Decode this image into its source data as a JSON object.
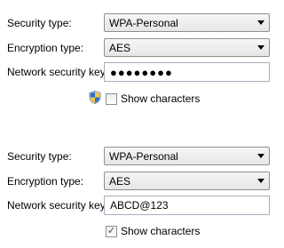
{
  "top_panel": {
    "security_type_label": "Security type:",
    "security_type_value": "WPA-Personal",
    "encryption_type_label": "Encryption type:",
    "encryption_type_value": "AES",
    "network_key_label": "Network security key",
    "network_key_value": "●●●●●●●●",
    "show_characters_label": "Show characters",
    "show_characters_checked": false,
    "shield_icon": "uac-shield-icon"
  },
  "bottom_panel": {
    "security_type_label": "Security type:",
    "security_type_value": "WPA-Personal",
    "encryption_type_label": "Encryption type:",
    "encryption_type_value": "AES",
    "network_key_label": "Network security key",
    "network_key_value": "ABCD@123",
    "show_characters_label": "Show characters",
    "show_characters_checked": true,
    "check_glyph": "✓"
  },
  "colors": {
    "combo_border": "#8f8f8f",
    "textbox_border": "#a6b0be",
    "check_color": "#2a4f87"
  }
}
